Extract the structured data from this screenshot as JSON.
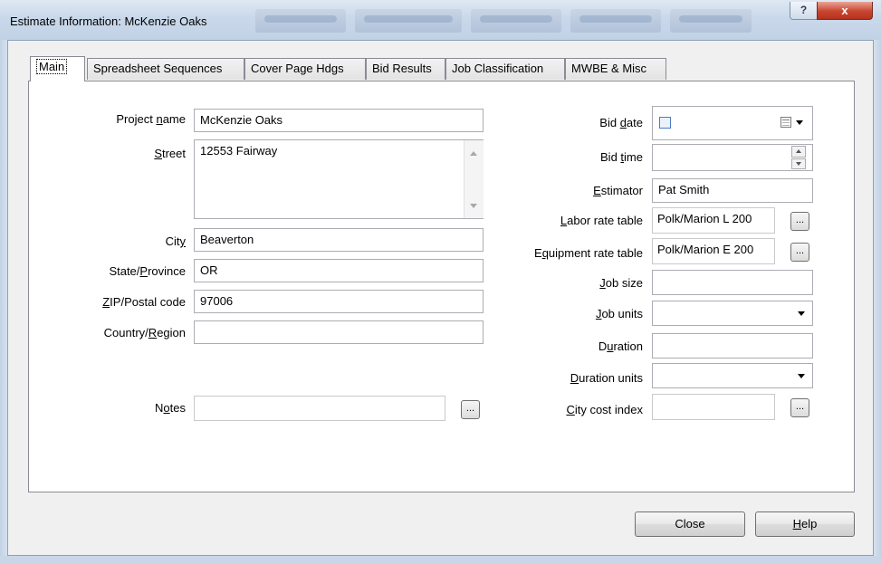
{
  "window": {
    "title": "Estimate Information: McKenzie Oaks",
    "help_glyph": "?",
    "close_glyph": "x"
  },
  "tabs": [
    {
      "label": "Main",
      "active": true
    },
    {
      "label": "Spreadsheet Sequences"
    },
    {
      "label": "Cover Page Hdgs"
    },
    {
      "label": "Bid Results"
    },
    {
      "label": "Job Classification"
    },
    {
      "label": "MWBE & Misc"
    }
  ],
  "left": {
    "project_name": {
      "pre": "Project ",
      "acc": "n",
      "post": "ame",
      "value": "McKenzie Oaks"
    },
    "street": {
      "pre": "",
      "acc": "S",
      "post": "treet",
      "value": "12553 Fairway"
    },
    "city": {
      "pre": "Cit",
      "acc": "y",
      "post": "",
      "value": "Beaverton"
    },
    "state": {
      "pre": "State/",
      "acc": "P",
      "post": "rovince",
      "value": "OR"
    },
    "zip": {
      "pre": "",
      "acc": "Z",
      "post": "IP/Postal code",
      "value": "97006"
    },
    "country": {
      "pre": "Country/",
      "acc": "R",
      "post": "egion",
      "value": ""
    },
    "notes": {
      "pre": "N",
      "acc": "o",
      "post": "tes",
      "value": "",
      "button": "..."
    }
  },
  "right": {
    "bid_date": {
      "pre": "Bid ",
      "acc": "d",
      "post": "ate",
      "value": ""
    },
    "bid_time": {
      "pre": "Bid ",
      "acc": "t",
      "post": "ime",
      "value": ""
    },
    "estimator": {
      "pre": "",
      "acc": "E",
      "post": "stimator",
      "value": "Pat Smith"
    },
    "labor_rate_table": {
      "pre": "",
      "acc": "L",
      "post": "abor rate table",
      "value": "Polk/Marion L 200",
      "button": "..."
    },
    "equipment_rate_table": {
      "pre": "E",
      "acc": "q",
      "post": "uipment rate table",
      "value": "Polk/Marion E 200",
      "button": "..."
    },
    "job_size": {
      "pre": "",
      "acc": "J",
      "post": "ob size",
      "value": ""
    },
    "job_units": {
      "pre": "",
      "acc": "J",
      "post": "ob units",
      "value": ""
    },
    "duration": {
      "pre": "D",
      "acc": "u",
      "post": "ration",
      "value": ""
    },
    "duration_units": {
      "pre": "",
      "acc": "D",
      "post": "uration units",
      "value": ""
    },
    "city_cost_index": {
      "pre": "",
      "acc": "C",
      "post": "ity cost index",
      "value": "",
      "button": "..."
    }
  },
  "buttons": {
    "close": "Close",
    "help_acc": "H",
    "help_post": "elp"
  },
  "colors": {
    "titlebar": "#c9d8ea",
    "close_button": "#c9452f",
    "dialog_bg": "#f0f0f0"
  }
}
